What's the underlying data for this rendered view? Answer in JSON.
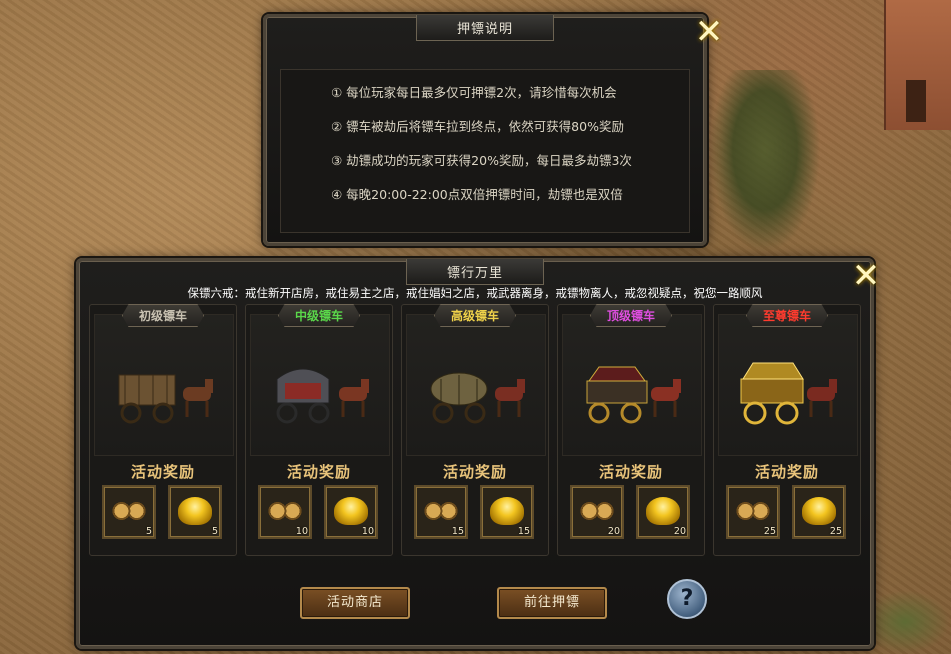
{
  "info_panel": {
    "title": "押镖说明",
    "rules": [
      "① 每位玩家每日最多仅可押镖2次，请珍惜每次机会",
      "② 镖车被劫后将镖车拉到终点，依然可获得80%奖励",
      "③ 劫镖成功的玩家可获得20%奖励，每日最多劫镖3次",
      "④ 每晚20:00-22:00点双倍押镖时间，劫镖也是双倍"
    ]
  },
  "escort_panel": {
    "title": "镖行万里",
    "tip": "保镖六戒：戒住新开店房，戒住易主之店，戒住娼妇之店，戒武器离身，戒镖物离人，戒忽视疑点，祝您一路顺风",
    "carts": [
      {
        "tier": "初级镖车",
        "tier_color": "#c9c2b2",
        "reward_label": "活动奖励",
        "coin_qty": "5",
        "ingot_qty": "5"
      },
      {
        "tier": "中级镖车",
        "tier_color": "#5ad84a",
        "reward_label": "活动奖励",
        "coin_qty": "10",
        "ingot_qty": "10"
      },
      {
        "tier": "高级镖车",
        "tier_color": "#f0d24a",
        "reward_label": "活动奖励",
        "coin_qty": "15",
        "ingot_qty": "15"
      },
      {
        "tier": "顶级镖车",
        "tier_color": "#e04ee0",
        "reward_label": "活动奖励",
        "coin_qty": "20",
        "ingot_qty": "20"
      },
      {
        "tier": "至尊镖车",
        "tier_color": "#ff3b2e",
        "reward_label": "活动奖励",
        "coin_qty": "25",
        "ingot_qty": "25"
      }
    ],
    "buttons": {
      "shop": "活动商店",
      "go_escort": "前往押镖",
      "help": "?"
    }
  }
}
